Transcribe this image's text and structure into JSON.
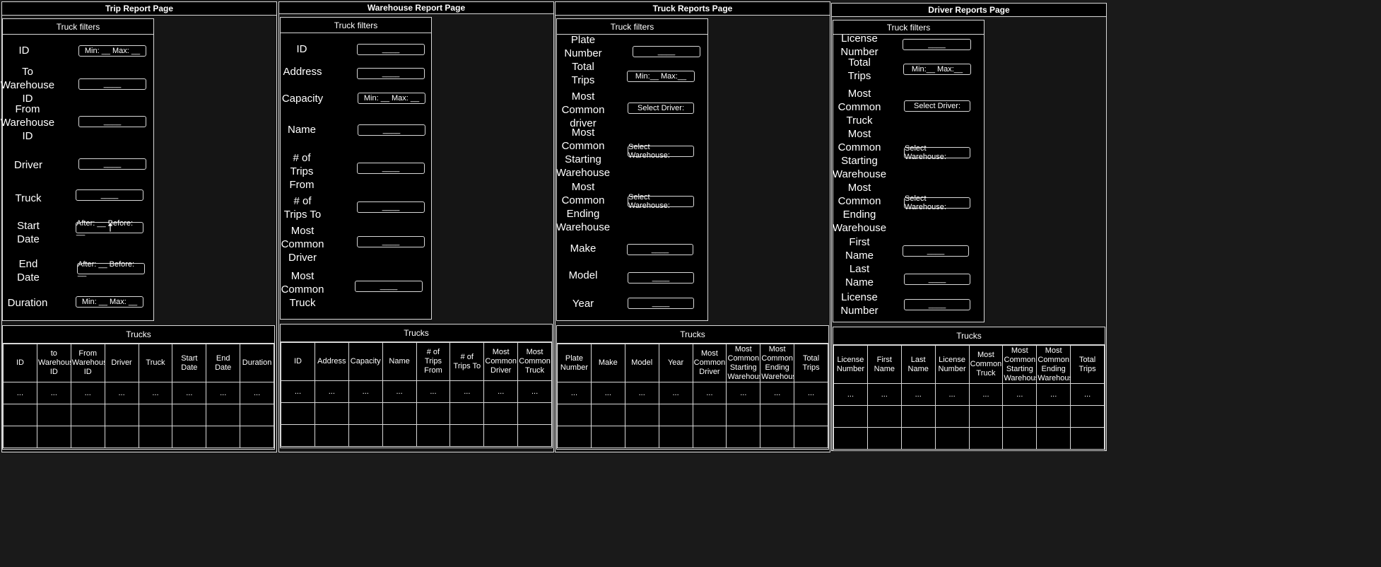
{
  "panels": [
    {
      "title": "Trip Report Page",
      "filters_title": "Truck filters",
      "filters": [
        {
          "label": "ID",
          "value": "Min: __ Max: __"
        },
        {
          "label": "To\nWarehouse\nID",
          "value": "____"
        },
        {
          "label": "From\nWarehouse\nID",
          "value": "____"
        },
        {
          "label": "Driver",
          "value": "____"
        },
        {
          "label": "Truck",
          "value": "____"
        },
        {
          "label": "Start\nDate",
          "value": "After: __ Before: __"
        },
        {
          "label": "End\nDate",
          "value": "After: __ Before: __"
        },
        {
          "label": "Duration",
          "value": "Min: __ Max: __"
        }
      ],
      "table_title": "Trucks",
      "columns": [
        "ID",
        "to Warehous ID",
        "From Warehous ID",
        "Driver",
        "Truck",
        "Start Date",
        "End Date",
        "Duration"
      ],
      "rows": [
        [
          "...",
          "...",
          "...",
          "...",
          "...",
          "...",
          "...",
          "..."
        ],
        [
          "",
          "",
          "",
          "",
          "",
          "",
          "",
          ""
        ],
        [
          "",
          "",
          "",
          "",
          "",
          "",
          "",
          ""
        ]
      ]
    },
    {
      "title": "Warehouse Report Page",
      "filters_title": "Truck filters",
      "filters": [
        {
          "label": "ID",
          "value": "____"
        },
        {
          "label": "Address",
          "value": "____"
        },
        {
          "label": "Capacity",
          "value": "Min: __ Max: __"
        },
        {
          "label": "Name",
          "value": "____"
        },
        {
          "label": "# of\nTrips\nFrom",
          "value": "____"
        },
        {
          "label": "# of\nTrips To",
          "value": "____"
        },
        {
          "label": "Most\nCommon\nDriver",
          "value": "____"
        },
        {
          "label": "Most\nCommon\nTruck",
          "value": "____"
        }
      ],
      "table_title": "Trucks",
      "columns": [
        "ID",
        "Address",
        "Capacity",
        "Name",
        "# of Trips From",
        "# of Trips To",
        "Most Common Driver",
        "Most Common Truck"
      ],
      "rows": [
        [
          "...",
          "...",
          "...",
          "...",
          "...",
          "...",
          "...",
          "..."
        ],
        [
          "",
          "",
          "",
          "",
          "",
          "",
          "",
          ""
        ],
        [
          "",
          "",
          "",
          "",
          "",
          "",
          "",
          ""
        ]
      ]
    },
    {
      "title": "Truck Reports Page",
      "filters_title": "Truck filters",
      "filters": [
        {
          "label": "Plate\nNumber",
          "value": "____"
        },
        {
          "label": "Total\nTrips",
          "value": "Min:__  Max:__"
        },
        {
          "label": "Most\nCommon\ndriver",
          "value": "Select Driver:"
        },
        {
          "label": "Most\nCommon\nStarting\nWarehouse",
          "value": "Select Warehouse:"
        },
        {
          "label": "Most\nCommon\nEnding\nWarehouse",
          "value": "Select Warehouse:"
        },
        {
          "label": "Make",
          "value": "____"
        },
        {
          "label": "Model",
          "value": "____"
        },
        {
          "label": "Year",
          "value": "____"
        }
      ],
      "table_title": "Trucks",
      "columns": [
        "Plate Number",
        "Make",
        "Model",
        "Year",
        "Most Common Driver",
        "Most Common Starting Warehous",
        "Most Common Ending Warehous",
        "Total Trips"
      ],
      "rows": [
        [
          "...",
          "...",
          "...",
          "...",
          "...",
          "...",
          "...",
          "..."
        ],
        [
          "",
          "",
          "",
          "",
          "",
          "",
          "",
          ""
        ],
        [
          "",
          "",
          "",
          "",
          "",
          "",
          "",
          ""
        ]
      ]
    },
    {
      "title": "Driver Reports Page",
      "filters_title": "Truck filters",
      "filters": [
        {
          "label": "License\nNumber",
          "value": "____"
        },
        {
          "label": "Total\nTrips",
          "value": "Min:__  Max:__"
        },
        {
          "label": "Most\nCommon\nTruck",
          "value": "Select Driver:"
        },
        {
          "label": "Most\nCommon\nStarting\nWarehouse",
          "value": "Select Warehouse:"
        },
        {
          "label": "Most\nCommon\nEnding\nWarehouse",
          "value": "Select Warehouse:"
        },
        {
          "label": "First\nName",
          "value": "____"
        },
        {
          "label": "Last\nName",
          "value": "____"
        },
        {
          "label": "License\nNumber",
          "value": "____"
        }
      ],
      "table_title": "Trucks",
      "columns": [
        "License Number",
        "First Name",
        "Last Name",
        "License Number",
        "Most Common Truck",
        "Most Common Starting Warehous",
        "Most Common Ending Warehous",
        "Total Trips"
      ],
      "rows": [
        [
          "...",
          "...",
          "...",
          "...",
          "...",
          "...",
          "...",
          "..."
        ],
        [
          "",
          "",
          "",
          "",
          "",
          "",
          "",
          ""
        ],
        [
          "",
          "",
          "",
          "",
          "",
          "",
          "",
          ""
        ]
      ]
    }
  ]
}
